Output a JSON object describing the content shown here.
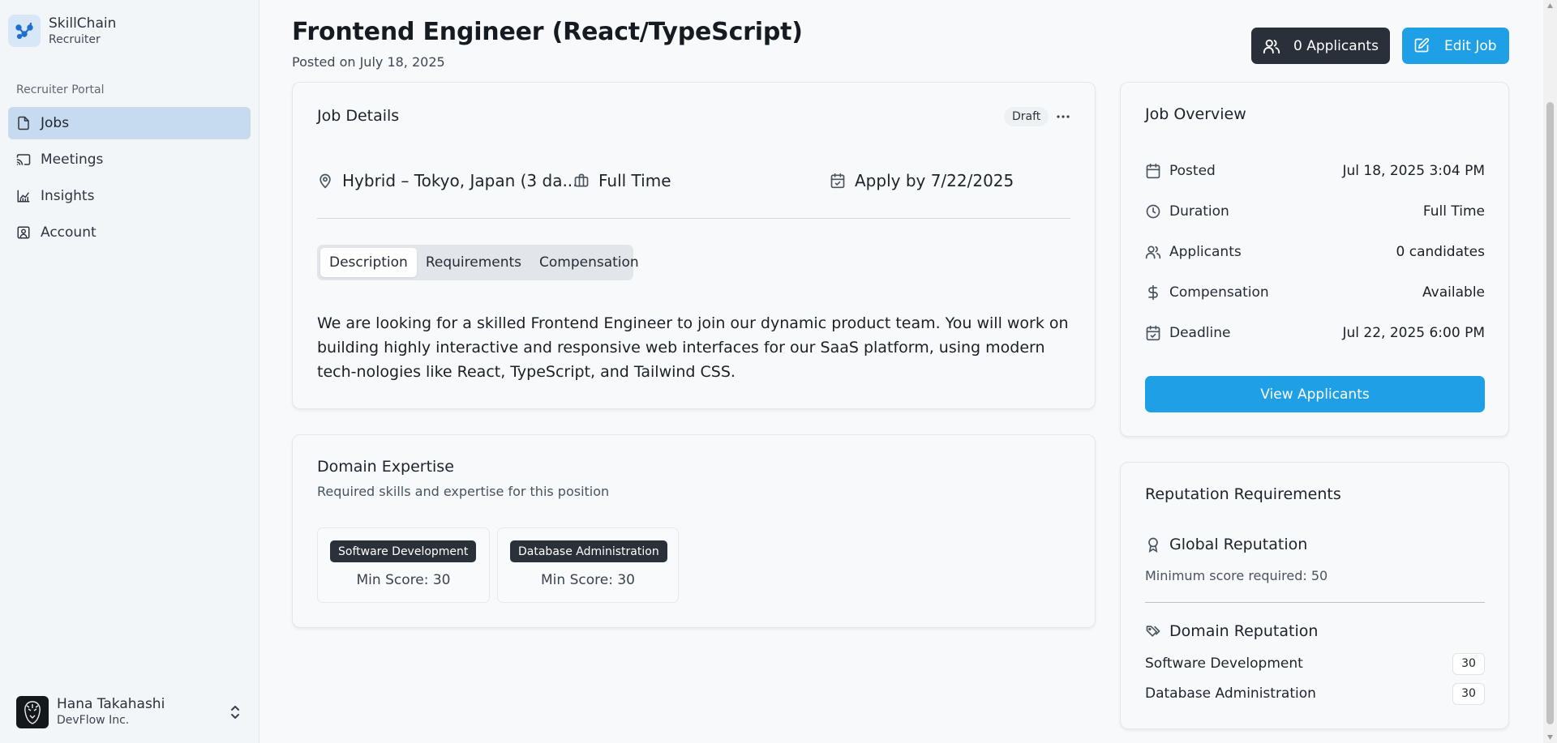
{
  "app": {
    "name": "SkillChain",
    "role": "Recruiter",
    "brand_color": "#1e9fe6"
  },
  "sidebar": {
    "group_label": "Recruiter Portal",
    "items": [
      {
        "label": "Jobs",
        "icon": "file-icon",
        "active": true
      },
      {
        "label": "Meetings",
        "icon": "cast-icon",
        "active": false
      },
      {
        "label": "Insights",
        "icon": "chart-icon",
        "active": false
      },
      {
        "label": "Account",
        "icon": "contact-icon",
        "active": false
      }
    ],
    "user": {
      "name": "Hana Takahashi",
      "org": "DevFlow Inc."
    }
  },
  "header": {
    "title": "Frontend Engineer (React/TypeScript)",
    "posted": "Posted on July 18, 2025",
    "applicants_button": "0 Applicants",
    "edit_button": "Edit Job"
  },
  "job_details": {
    "title": "Job Details",
    "status": "Draft",
    "location": "Hybrid – Tokyo, Japan (3 da...",
    "type": "Full Time",
    "apply_by": "Apply by 7/22/2025",
    "tabs": [
      "Description",
      "Requirements",
      "Compensation"
    ],
    "active_tab": "Description",
    "description": "We are looking for a skilled Frontend Engineer to join our dynamic product team. You will work on building highly interactive and responsive web interfaces for our SaaS platform, using modern tech-nologies like React, TypeScript, and Tailwind CSS."
  },
  "domain_expertise": {
    "title": "Domain Expertise",
    "subtitle": "Required skills and expertise for this position",
    "skills": [
      {
        "name": "Software Development",
        "min_score": "Min Score: 30"
      },
      {
        "name": "Database Administration",
        "min_score": "Min Score: 30"
      }
    ]
  },
  "overview": {
    "title": "Job Overview",
    "rows": [
      {
        "label": "Posted",
        "value": "Jul 18, 2025 3:04 PM",
        "icon": "calendar-icon"
      },
      {
        "label": "Duration",
        "value": "Full Time",
        "icon": "clock-icon"
      },
      {
        "label": "Applicants",
        "value": "0 candidates",
        "icon": "users-icon"
      },
      {
        "label": "Compensation",
        "value": "Available",
        "icon": "dollar-icon"
      },
      {
        "label": "Deadline",
        "value": "Jul 22, 2025 6:00 PM",
        "icon": "calendar-check-icon"
      }
    ],
    "view_button": "View Applicants"
  },
  "reputation": {
    "title": "Reputation Requirements",
    "global_title": "Global Reputation",
    "global_min": "Minimum score required: 50",
    "domain_title": "Domain Reputation",
    "domains": [
      {
        "name": "Software Development",
        "score": "30"
      },
      {
        "name": "Database Administration",
        "score": "30"
      }
    ]
  }
}
